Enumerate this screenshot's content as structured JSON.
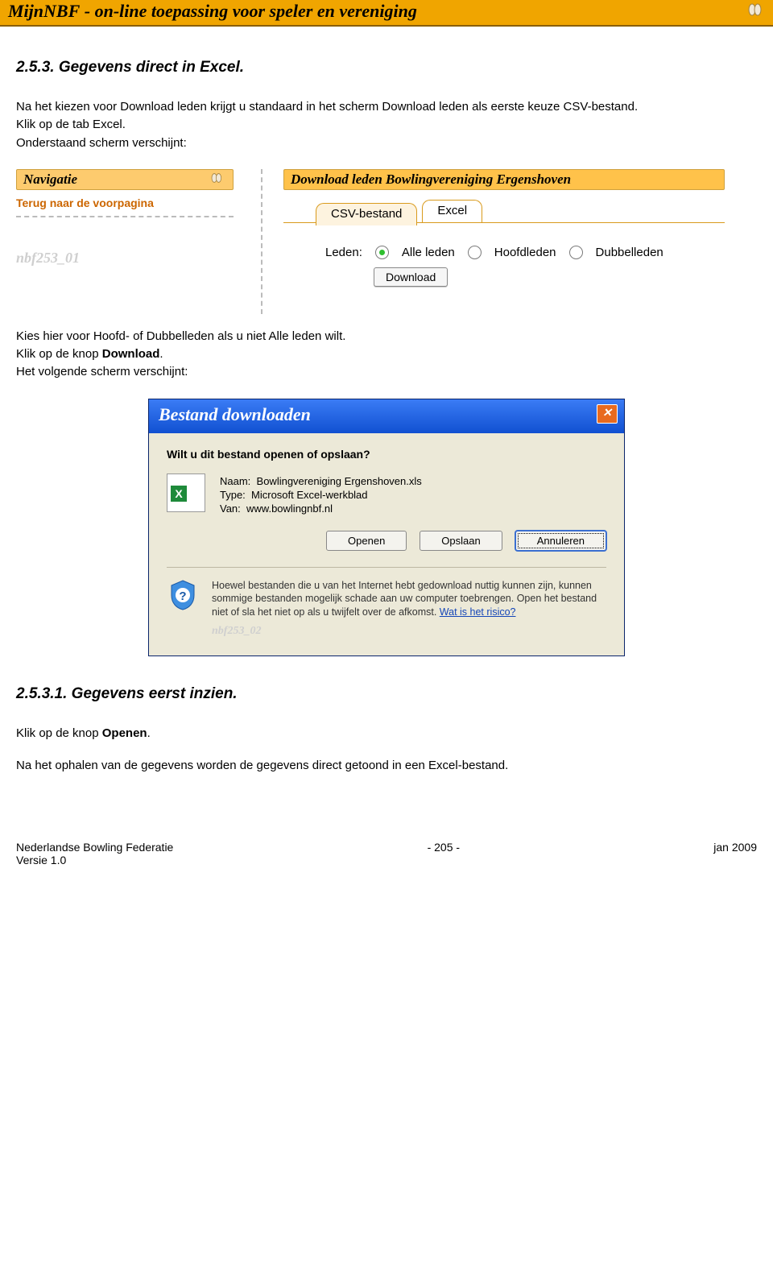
{
  "banner": {
    "title_prefix": "MijnNBF",
    "title_rest": " - on-line toepassing voor speler en vereniging"
  },
  "section1": {
    "heading": "2.5.3. Gegevens direct in Excel.",
    "p1": "Na het kiezen voor Download leden krijgt u standaard in het scherm Download leden als eerste keuze CSV-bestand.",
    "p2": "Klik op de tab Excel.",
    "p3": "Onderstaand scherm verschijnt:"
  },
  "app": {
    "nav_header": "Navigatie",
    "nav_link": "Terug naar de voorpagina",
    "download_header": "Download leden Bowlingvereniging Ergenshoven",
    "tab1": "CSV-bestand",
    "tab2": "Excel",
    "leden_label": "Leden:",
    "opt1": "Alle leden",
    "opt2": "Hoofdleden",
    "opt3": "Dubbelleden",
    "download_btn": "Download",
    "screenshot_id": "nbf253_01"
  },
  "mid": {
    "p1": "Kies hier voor Hoofd- of Dubbelleden als u niet Alle leden wilt.",
    "p2_a": "Klik op de knop ",
    "p2_b": "Download",
    "p2_c": ".",
    "p3": "Het volgende scherm verschijnt:"
  },
  "dialog": {
    "title": "Bestand downloaden",
    "question": "Wilt u dit bestand openen of opslaan?",
    "name_label": "Naam:",
    "name_value": "Bowlingvereniging Ergenshoven.xls",
    "type_label": "Type:",
    "type_value": "Microsoft Excel-werkblad",
    "from_label": "Van:",
    "from_value": "www.bowlingnbf.nl",
    "btn_open": "Openen",
    "btn_save": "Opslaan",
    "btn_cancel": "Annuleren",
    "warning": "Hoewel bestanden die u van het Internet hebt gedownload nuttig kunnen zijn, kunnen sommige bestanden mogelijk schade aan uw computer toebrengen. Open het bestand niet of sla het niet op als u twijfelt over de afkomst. ",
    "warning_link": "Wat is het risico?",
    "screenshot_id": "nbf253_02"
  },
  "section2": {
    "heading": "2.5.3.1. Gegevens eerst inzien.",
    "p1_a": "Klik op de knop ",
    "p1_b": "Openen",
    "p1_c": ".",
    "p2": "Na het ophalen van de gegevens worden de gegevens direct getoond in een Excel-bestand."
  },
  "footer": {
    "left": "Nederlandse Bowling Federatie",
    "mid": "- 205 -",
    "right": "jan 2009",
    "version": "Versie 1.0"
  }
}
